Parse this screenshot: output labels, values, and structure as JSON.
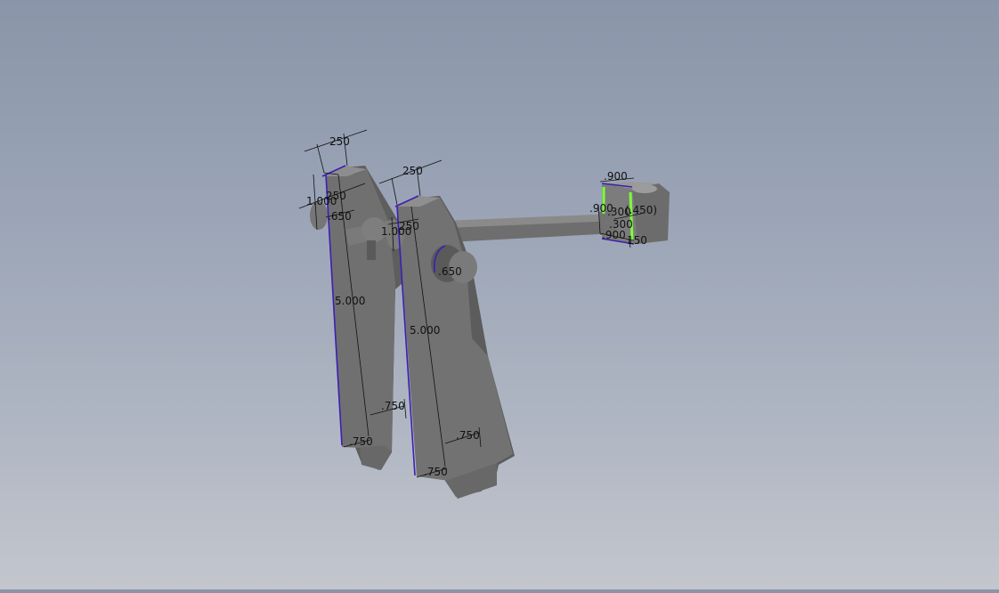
{
  "viewport": {
    "background_top": "#8a95a9",
    "background_bottom": "#c3c6cd",
    "part_face": "#6f6f6f",
    "part_side": "#5a5a5a",
    "part_top": "#8a8a8a",
    "sketch_line_color": "#3c1eb4",
    "selected_edge_color": "#7cff3a",
    "dimension_color": "#111111"
  },
  "dimensions": {
    "left_top_width": "250",
    "left_inner_width": "250",
    "left_height_small": "1.000",
    "left_pin": ".650",
    "left_length": "5.000",
    "left_foot_upper": ".750",
    "left_foot_lower": ".750",
    "right_top_width": "250",
    "right_inner_width": "250",
    "right_height_small": "1.000",
    "right_pin": ".650",
    "right_length": "5.000",
    "right_foot_upper": ".750",
    "right_foot_lower": ".750",
    "end_top": ".900",
    "end_left": ".900",
    "end_mid": ".300",
    "end_ref": "(.450)",
    "end_small": ".300",
    "end_bottom_left": ".900",
    "end_bottom_right": "150"
  }
}
